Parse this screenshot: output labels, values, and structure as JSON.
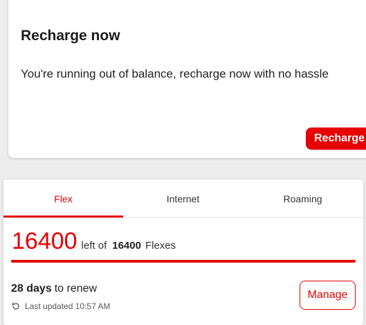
{
  "recharge": {
    "title": "Recharge now",
    "description": "You're running out of balance, recharge now with no hassle",
    "button_label": "Recharge"
  },
  "plan": {
    "tabs": [
      {
        "label": "Flex",
        "active": true
      },
      {
        "label": "Internet",
        "active": false
      },
      {
        "label": "Roaming",
        "active": false
      }
    ],
    "balance": {
      "value": "16400",
      "left_of_label": "left of",
      "total": "16400",
      "unit": "Flexes",
      "remaining_fraction": 1.0
    },
    "renew": {
      "days": "28 days",
      "label": "to renew"
    },
    "last_updated": "Last updated 10:57 AM",
    "manage_label": "Manage"
  },
  "colors": {
    "accent": "#e60000",
    "background": "#ededed",
    "card": "#ffffff"
  }
}
